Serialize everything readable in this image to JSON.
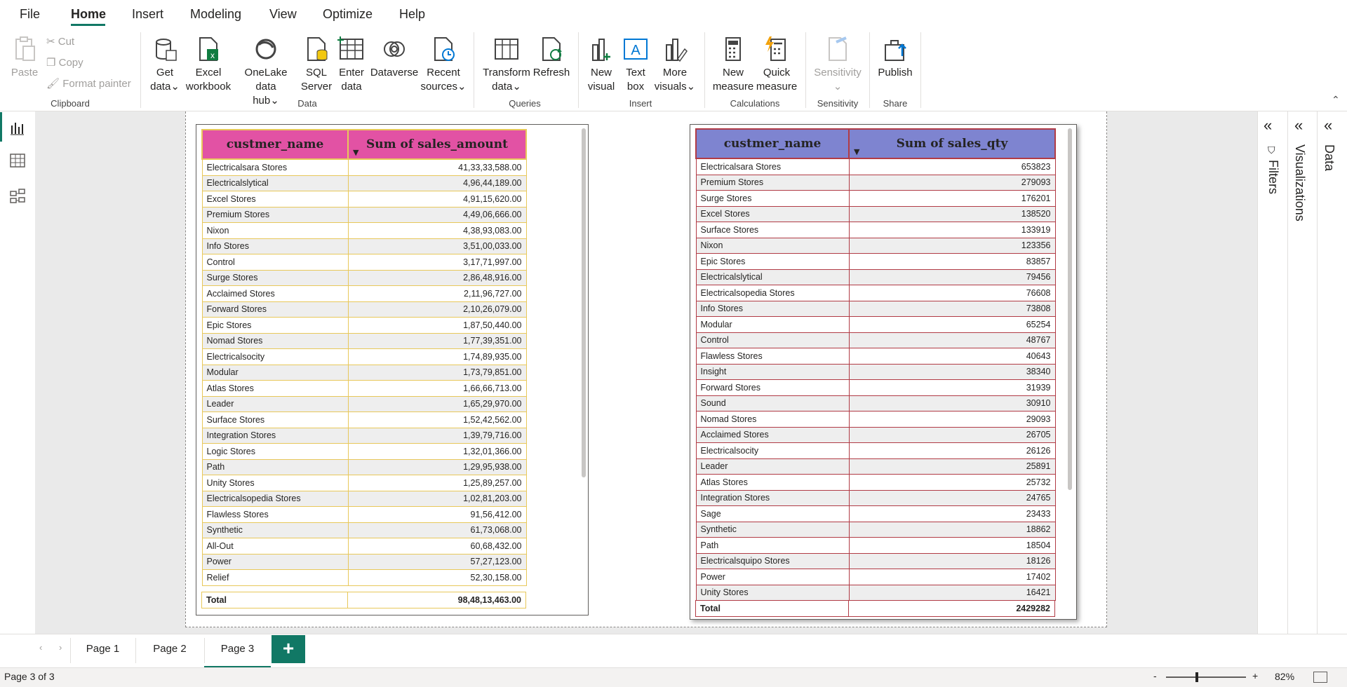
{
  "menu": {
    "items": [
      "File",
      "Home",
      "Insert",
      "Modeling",
      "View",
      "Optimize",
      "Help"
    ],
    "active": "Home"
  },
  "ribbon": {
    "clipboard": {
      "paste": "Paste",
      "cut": "Cut",
      "copy": "Copy",
      "format_painter": "Format painter",
      "label": "Clipboard"
    },
    "data": {
      "get_data": [
        "Get",
        "data"
      ],
      "excel": [
        "Excel",
        "workbook"
      ],
      "onelake": [
        "OneLake data",
        "hub"
      ],
      "sql": [
        "SQL",
        "Server"
      ],
      "enter": [
        "Enter",
        "data"
      ],
      "dataverse": "Dataverse",
      "recent": [
        "Recent",
        "sources"
      ],
      "label": "Data"
    },
    "queries": {
      "transform": [
        "Transform",
        "data"
      ],
      "refresh": "Refresh",
      "label": "Queries"
    },
    "insert": {
      "new_visual": [
        "New",
        "visual"
      ],
      "text_box": [
        "Text",
        "box"
      ],
      "more_visuals": [
        "More",
        "visuals"
      ],
      "label": "Insert"
    },
    "calculations": {
      "new_measure": [
        "New",
        "measure"
      ],
      "quick_measure": [
        "Quick",
        "measure"
      ],
      "label": "Calculations"
    },
    "sensitivity": {
      "btn": "Sensitivity",
      "label": "Sensitivity"
    },
    "share": {
      "publish": "Publish",
      "label": "Share"
    }
  },
  "panes": {
    "filters": "Filters",
    "visualizations": "Visualizations",
    "data": "Data"
  },
  "table1": {
    "headers": [
      "custmer_name",
      "Sum of sales_amount"
    ],
    "rows": [
      [
        "Electricalsara Stores",
        "41,33,33,588.00"
      ],
      [
        "Electricalslytical",
        "4,96,44,189.00"
      ],
      [
        "Excel Stores",
        "4,91,15,620.00"
      ],
      [
        "Premium Stores",
        "4,49,06,666.00"
      ],
      [
        "Nixon",
        "4,38,93,083.00"
      ],
      [
        "Info Stores",
        "3,51,00,033.00"
      ],
      [
        "Control",
        "3,17,71,997.00"
      ],
      [
        "Surge Stores",
        "2,86,48,916.00"
      ],
      [
        "Acclaimed Stores",
        "2,11,96,727.00"
      ],
      [
        "Forward Stores",
        "2,10,26,079.00"
      ],
      [
        "Epic Stores",
        "1,87,50,440.00"
      ],
      [
        "Nomad Stores",
        "1,77,39,351.00"
      ],
      [
        "Electricalsocity",
        "1,74,89,935.00"
      ],
      [
        "Modular",
        "1,73,79,851.00"
      ],
      [
        "Atlas Stores",
        "1,66,66,713.00"
      ],
      [
        "Leader",
        "1,65,29,970.00"
      ],
      [
        "Surface Stores",
        "1,52,42,562.00"
      ],
      [
        "Integration Stores",
        "1,39,79,716.00"
      ],
      [
        "Logic Stores",
        "1,32,01,366.00"
      ],
      [
        "Path",
        "1,29,95,938.00"
      ],
      [
        "Unity Stores",
        "1,25,89,257.00"
      ],
      [
        "Electricalsopedia Stores",
        "1,02,81,203.00"
      ],
      [
        "Flawless Stores",
        "91,56,412.00"
      ],
      [
        "Synthetic",
        "61,73,068.00"
      ],
      [
        "All-Out",
        "60,68,432.00"
      ],
      [
        "Power",
        "57,27,123.00"
      ],
      [
        "Relief",
        "52,30,158.00"
      ]
    ],
    "total": [
      "Total",
      "98,48,13,463.00"
    ]
  },
  "table2": {
    "headers": [
      "custmer_name",
      "Sum of sales_qty"
    ],
    "rows": [
      [
        "Electricalsara Stores",
        "653823"
      ],
      [
        "Premium Stores",
        "279093"
      ],
      [
        "Surge Stores",
        "176201"
      ],
      [
        "Excel Stores",
        "138520"
      ],
      [
        "Surface Stores",
        "133919"
      ],
      [
        "Nixon",
        "123356"
      ],
      [
        "Epic Stores",
        "83857"
      ],
      [
        "Electricalslytical",
        "79456"
      ],
      [
        "Electricalsopedia Stores",
        "76608"
      ],
      [
        "Info Stores",
        "73808"
      ],
      [
        "Modular",
        "65254"
      ],
      [
        "Control",
        "48767"
      ],
      [
        "Flawless Stores",
        "40643"
      ],
      [
        "Insight",
        "38340"
      ],
      [
        "Forward Stores",
        "31939"
      ],
      [
        "Sound",
        "30910"
      ],
      [
        "Nomad Stores",
        "29093"
      ],
      [
        "Acclaimed Stores",
        "26705"
      ],
      [
        "Electricalsocity",
        "26126"
      ],
      [
        "Leader",
        "25891"
      ],
      [
        "Atlas Stores",
        "25732"
      ],
      [
        "Integration Stores",
        "24765"
      ],
      [
        "Sage",
        "23433"
      ],
      [
        "Synthetic",
        "18862"
      ],
      [
        "Path",
        "18504"
      ],
      [
        "Electricalsquipo Stores",
        "18126"
      ],
      [
        "Power",
        "17402"
      ],
      [
        "Unity Stores",
        "16421"
      ]
    ],
    "total": [
      "Total",
      "2429282"
    ]
  },
  "tabs": [
    "Page 1",
    "Page 2",
    "Page 3"
  ],
  "active_tab": "Page 3",
  "status": {
    "page_info": "Page 3 of 3",
    "zoom": "82%",
    "minus": "-",
    "plus": "+"
  }
}
